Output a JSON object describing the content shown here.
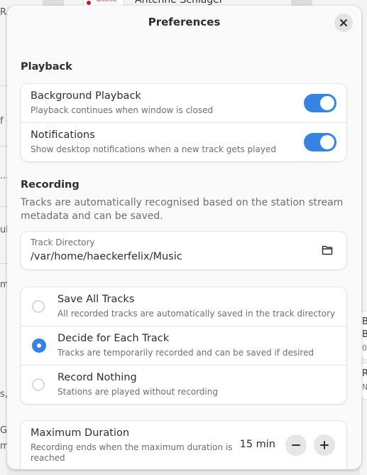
{
  "background": {
    "station_name": "Antenne Schlager",
    "logo_text": "antenne",
    "left_fragments": [
      "Ra",
      "f (",
      "...",
      "ub",
      "m",
      "s,",
      "Gl",
      "m"
    ],
    "right_fragments": [
      "B",
      "B",
      "0",
      "R",
      "N"
    ]
  },
  "dialog": {
    "title": "Preferences",
    "close_icon": "close-icon"
  },
  "playback": {
    "section_title": "Playback",
    "rows": [
      {
        "title": "Background Playback",
        "subtitle": "Playback continues when window is closed",
        "enabled": true
      },
      {
        "title": "Notifications",
        "subtitle": "Show desktop notifications when a new track gets played",
        "enabled": true
      }
    ]
  },
  "recording": {
    "section_title": "Recording",
    "description": "Tracks are automatically recognised based on the station stream metadata and can be saved.",
    "track_directory": {
      "label": "Track Directory",
      "value": "/var/home/haeckerfelix/Music",
      "icon": "folder-icon"
    },
    "options": [
      {
        "title": "Save All Tracks",
        "subtitle": "All recorded tracks are automatically saved in the track directory",
        "selected": false
      },
      {
        "title": "Decide for Each Track",
        "subtitle": "Tracks are temporarily recorded and can be saved if desired",
        "selected": true
      },
      {
        "title": "Record Nothing",
        "subtitle": "Stations are played without recording",
        "selected": false
      }
    ],
    "max_duration": {
      "title": "Maximum Duration",
      "subtitle": "Recording ends when the maximum duration is reached",
      "value": "15 min",
      "decrement": "−",
      "increment": "+"
    }
  },
  "colors": {
    "accent": "#3584e4",
    "dialog_bg": "#fafafa",
    "card_bg": "#ffffff"
  }
}
